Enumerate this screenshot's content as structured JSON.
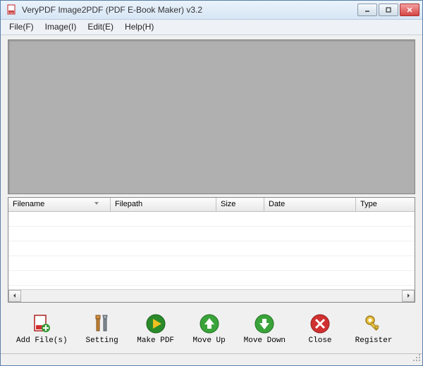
{
  "window": {
    "title": "VeryPDF Image2PDF (PDF E-Book Maker) v3.2"
  },
  "menu": {
    "file": "File(F)",
    "image": "Image(I)",
    "edit": "Edit(E)",
    "help": "Help(H)"
  },
  "table": {
    "columns": {
      "filename": "Filename",
      "filepath": "Filepath",
      "size": "Size",
      "date": "Date",
      "type": "Type"
    },
    "rows": []
  },
  "toolbar": {
    "add_files": "Add File(s)",
    "setting": "Setting",
    "make_pdf": "Make PDF",
    "move_up": "Move Up",
    "move_down": "Move Down",
    "close": "Close",
    "register": "Register"
  }
}
